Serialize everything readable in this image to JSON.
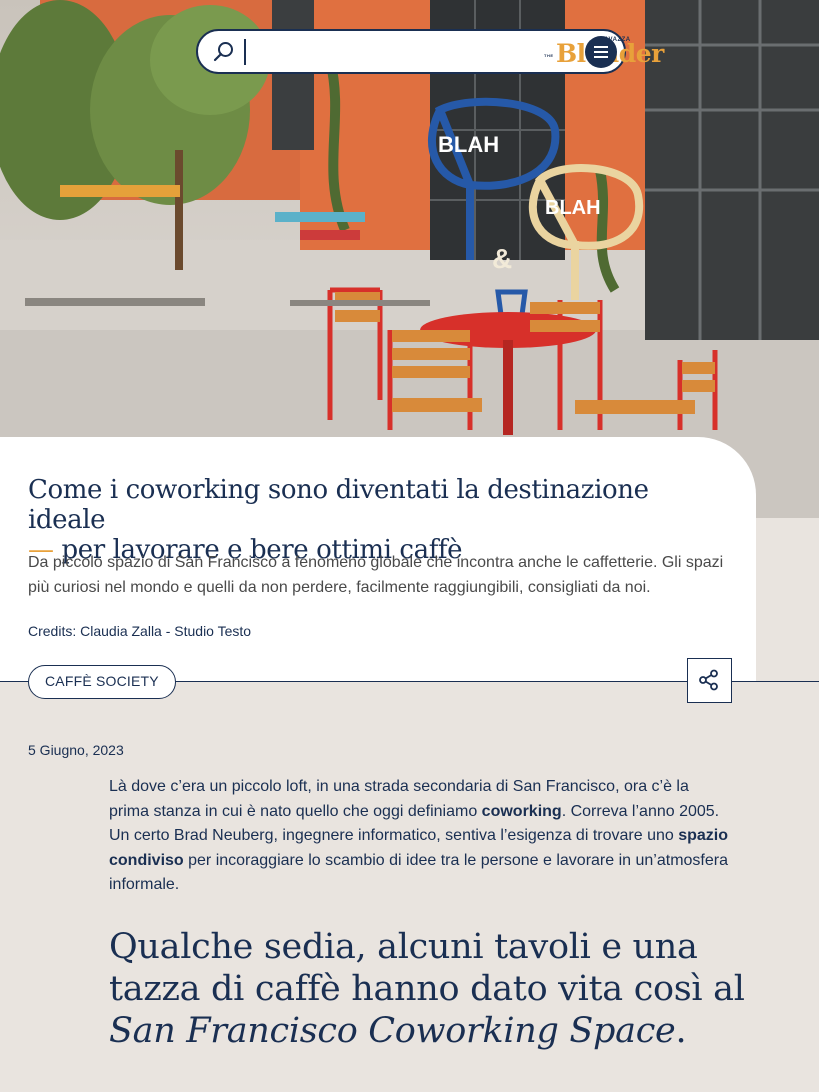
{
  "header": {
    "logo_brand": "LAVAZZA",
    "logo_the": "THE",
    "logo_name": "Blender",
    "search_icon": "search-icon",
    "menu_icon": "hamburger-menu-icon",
    "accent_color": "#e8a13a",
    "navy_color": "#1a2f52"
  },
  "hero": {
    "graffiti_text_1": "BLAH",
    "graffiti_text_2": "BLAH",
    "graffiti_text_3": "&"
  },
  "article": {
    "title_part1": "Come i coworking sono diventati la destinazione ideale",
    "title_dash": "—",
    "title_part2": "per lavorare e bere ottimi caffè",
    "subtitle": "Da piccolo spazio di San Francisco a fenomeno globale che incontra anche le caffetterie. Gli spazi più curiosi nel mondo e quelli da non perdere, facilmente raggiungibili, consigliati da noi.",
    "credits": "Credits: Claudia Zalla - Studio Testo",
    "tag": "CAFFÈ SOCIETY",
    "share_icon": "share-icon",
    "date": "5 Giugno, 2023",
    "body": {
      "p1": "Là dove c’era un piccolo loft, in una strada secondaria di San Francisco, ora c’è la prima stanza in cui è nato quello che oggi definiamo ",
      "b1": "coworking",
      "p2": ". Correva l’anno 2005. Un certo Brad Neuberg, ingegnere informatico, sentiva l’esigenza di trovare uno ",
      "b2": "spazio condiviso",
      "p3": " per incoraggiare lo scambio di idee tra le persone e lavorare in un’atmosfera informale."
    },
    "quote_part1": "Qualche sedia, alcuni tavoli e una tazza di caffè hanno dato vita così al ",
    "quote_italic": "San Francisco Coworking Space",
    "quote_end": "."
  }
}
